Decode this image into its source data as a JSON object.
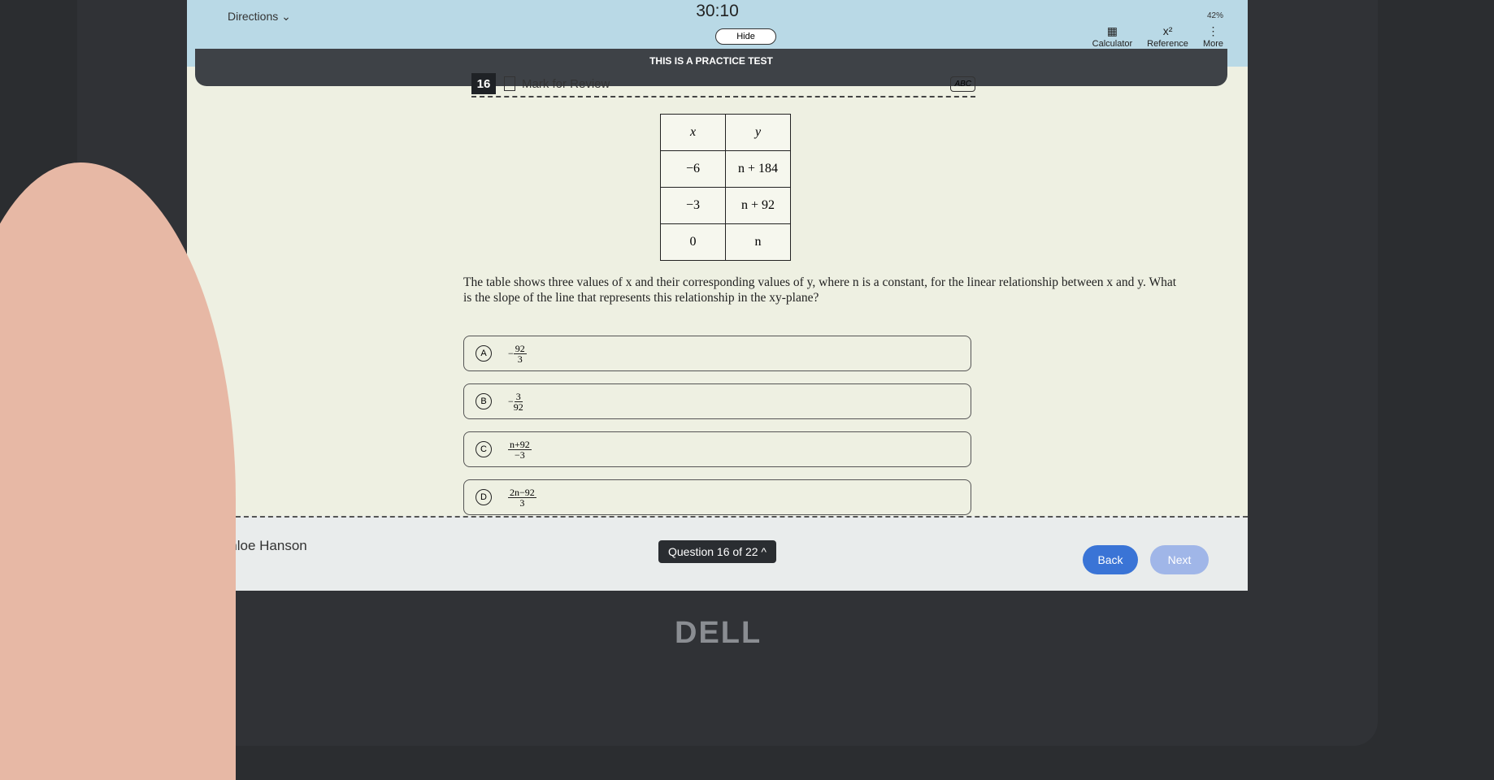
{
  "header": {
    "directions": "Directions",
    "timer": "30:10",
    "hide": "Hide",
    "battery": "42%",
    "tools": [
      {
        "label": "Calculator",
        "icon": "calculator-icon",
        "glyph": "▦"
      },
      {
        "label": "Reference",
        "icon": "reference-icon",
        "glyph": "x²"
      },
      {
        "label": "More",
        "icon": "more-icon",
        "glyph": "⋮"
      }
    ],
    "banner": "THIS IS A PRACTICE TEST"
  },
  "question": {
    "number": "16",
    "mark": "Mark for Review",
    "abc": "ABC",
    "table": {
      "headers": [
        "x",
        "y"
      ],
      "rows": [
        [
          "−6",
          "n + 184"
        ],
        [
          "−3",
          "n + 92"
        ],
        [
          "0",
          "n"
        ]
      ]
    },
    "prompt": "The table shows three values of x and their corresponding values of y, where n is a constant, for the linear relationship between x and y. What is the slope of the line that represents this relationship in the xy-plane?",
    "choices": [
      {
        "letter": "A",
        "sign": "−",
        "num": "92",
        "den": "3"
      },
      {
        "letter": "B",
        "sign": "−",
        "num": "3",
        "den": "92"
      },
      {
        "letter": "C",
        "sign": "",
        "num": "n+92",
        "den": "−3"
      },
      {
        "letter": "D",
        "sign": "",
        "num": "2n−92",
        "den": "3"
      }
    ]
  },
  "footer": {
    "name": "Chloe Hanson",
    "nav": "Question 16 of 22 ^",
    "back": "Back",
    "next": "Next"
  },
  "device": {
    "logo": "DELL"
  }
}
